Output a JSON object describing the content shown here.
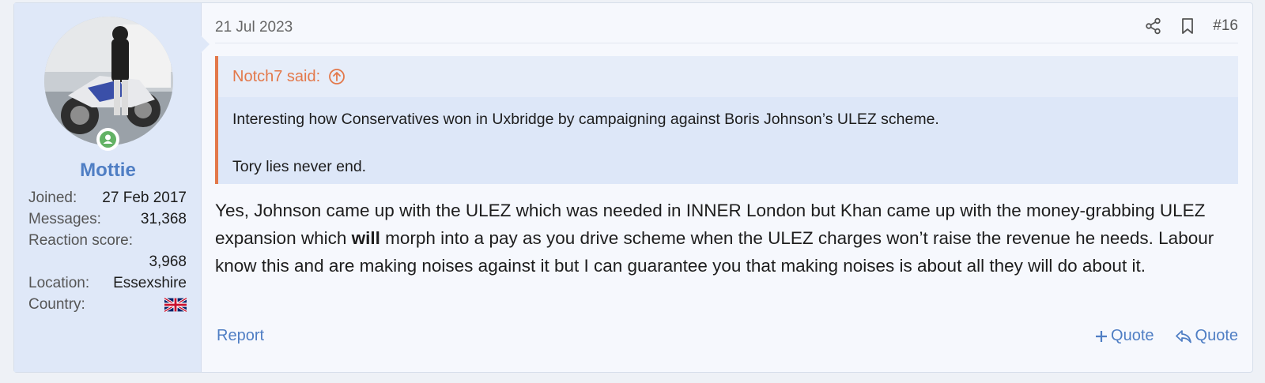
{
  "user": {
    "name": "Mottie",
    "online_status": "online",
    "stats": [
      {
        "label": "Joined:",
        "value": "27 Feb 2017"
      },
      {
        "label": "Messages:",
        "value": "31,368"
      },
      {
        "label": "Reaction score:",
        "value": "3,968"
      },
      {
        "label": "Location:",
        "value": "Essexshire"
      },
      {
        "label": "Country:",
        "value": "United Kingdom flag"
      }
    ]
  },
  "post": {
    "date": "21 Jul 2023",
    "number": "#16",
    "icons": [
      "share-icon",
      "bookmark-icon"
    ],
    "quote": {
      "author_line": "Notch7 said:",
      "lines": [
        "Interesting how Conservatives won in Uxbridge by campaigning against Boris Johnson’s ULEZ scheme.",
        "Tory lies never end."
      ]
    },
    "message_before_bold": "Yes, Johnson came up with the ULEZ which was needed in INNER London but Khan came up with the money-grabbing ULEZ expansion which ",
    "message_bold": "will",
    "message_after_bold": " morph into a pay as you drive scheme when the ULEZ charges won’t raise the revenue he needs. Labour know this and are making noises against it but I can guarantee you that making noises is about all they will do about it.",
    "footer": {
      "report_label": "Report",
      "multiquote_label": "Quote",
      "quote_label": "Quote"
    }
  },
  "colors": {
    "accent": "#4f7ec4",
    "quote_accent": "#e3784a",
    "online": "#63b265"
  }
}
